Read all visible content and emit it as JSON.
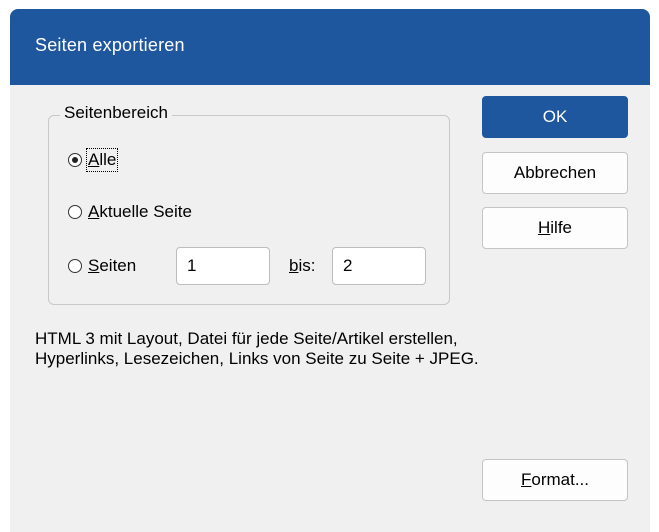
{
  "window": {
    "title": "Seiten exportieren"
  },
  "range_group": {
    "legend": "Seitenbereich",
    "options": [
      {
        "label": "Alle",
        "accel": "A",
        "rest": "lle",
        "checked": true
      },
      {
        "label": "Aktuelle Seite",
        "accel": "A",
        "rest": "ktuelle Seite",
        "checked": false
      },
      {
        "label": "Seiten",
        "accel": "S",
        "rest": "eiten",
        "checked": false
      }
    ],
    "from_value": "1",
    "to_label_accel": "b",
    "to_label_rest": "is:",
    "to_value": "2"
  },
  "buttons": {
    "ok": "OK",
    "cancel": "Abbrechen",
    "help_accel": "H",
    "help_rest": "ilfe",
    "format_accel": "F",
    "format_rest": "ormat..."
  },
  "description": {
    "line1": "HTML 3 mit Layout, Datei für jede Seite/Artikel erstellen,",
    "line2": "Hyperlinks, Lesezeichen, Links von Seite zu Seite + JPEG."
  },
  "colors": {
    "accent": "#1f579e",
    "dialog_bg": "#f0f0f0"
  }
}
